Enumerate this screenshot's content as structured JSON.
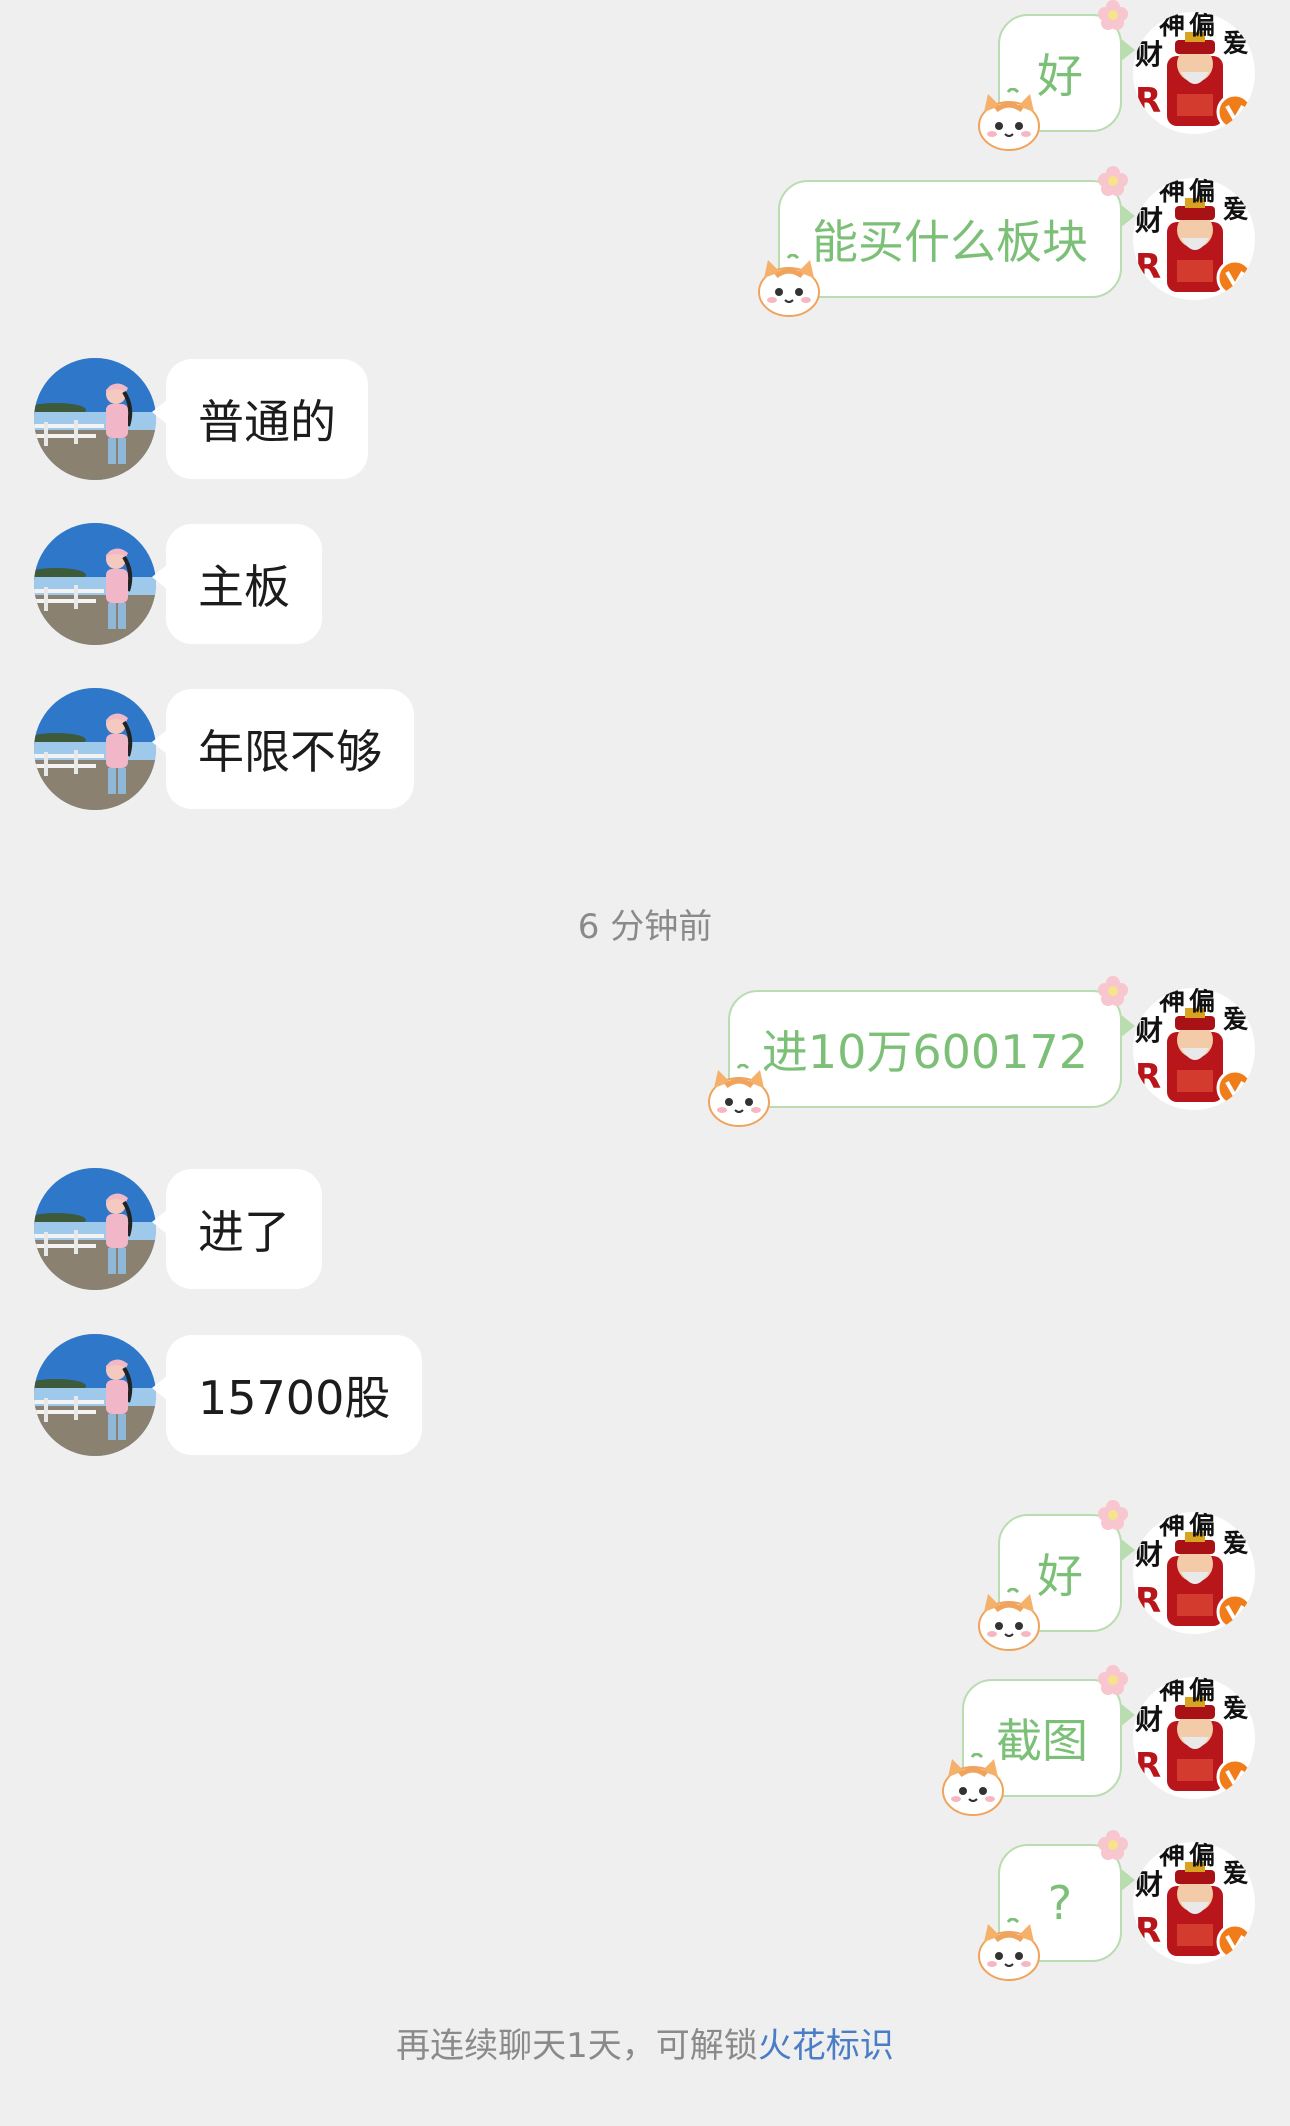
{
  "messages": [
    {
      "side": "out",
      "text": "好"
    },
    {
      "side": "out",
      "text": "能买什么板块"
    },
    {
      "side": "in",
      "text": "普通的"
    },
    {
      "side": "in",
      "text": "主板"
    },
    {
      "side": "in",
      "text": "年限不够"
    },
    {
      "side": "out",
      "text": "进10万600172"
    },
    {
      "side": "in",
      "text": "进了"
    },
    {
      "side": "in",
      "text": "15700股"
    },
    {
      "side": "out",
      "text": "好"
    },
    {
      "side": "out",
      "text": "截图"
    },
    {
      "side": "out",
      "text": "?"
    }
  ],
  "timestamp": "6 分钟前",
  "footer": {
    "hint": "再连续聊天1天，可解锁",
    "link": "火花标识"
  },
  "sender_avatar": {
    "sticker_text_1": "财",
    "sticker_text_2": "神",
    "sticker_text_3": "偏",
    "sticker_text_4": "爱",
    "badge": "V"
  },
  "colors": {
    "background": "#efefef",
    "incoming_bubble": "#ffffff",
    "outgoing_text": "#7cc078",
    "outgoing_border": "#b9ddb0",
    "link": "#4a7dc6",
    "badge": "#f07d1a"
  }
}
